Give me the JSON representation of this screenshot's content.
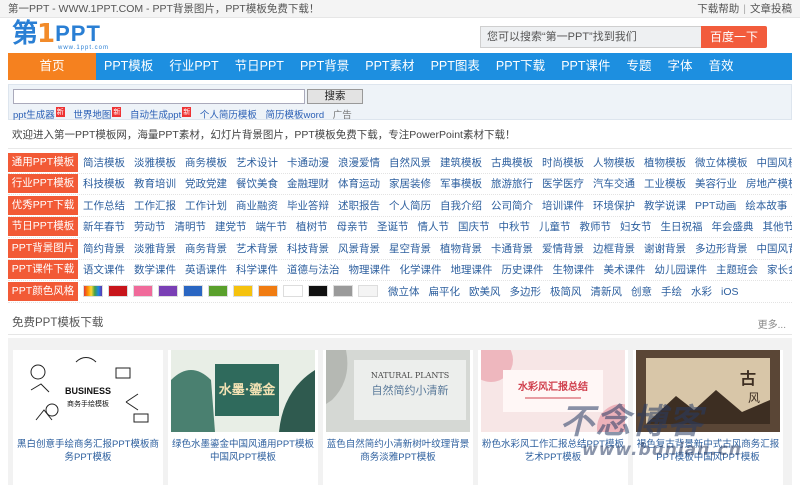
{
  "topbar": {
    "site_text": "第一PPT - WWW.1PPT.COM - PPT背景图片，PPT模板免费下载！",
    "links": [
      "下载帮助",
      "文章投稿"
    ]
  },
  "logo": {
    "part1": "第",
    "part2": "1",
    "part3": "PPT",
    "sub": "www.1ppt.com"
  },
  "search": {
    "placeholder": "您可以搜索“第一PPT”找到我们",
    "button": "百度一下"
  },
  "nav": {
    "home": "首页",
    "items": [
      "PPT模板",
      "行业PPT",
      "节日PPT",
      "PPT背景",
      "PPT素材",
      "PPT图表",
      "PPT下载",
      "PPT课件",
      "专题",
      "字体",
      "音效"
    ]
  },
  "subsearch": {
    "button": "搜索",
    "hot": [
      "ppt生成器",
      "世界地图",
      "自动生成ppt",
      "个人简历模板",
      "简历模板word",
      "广告"
    ],
    "new_badge": "新"
  },
  "welcome": "欢迎进入第一PPT模板网，海量PPT素材，幻灯片背景图片，PPT模板免费下载，专注PowerPoint素材下载！",
  "categories": [
    {
      "label": "通用PPT模板",
      "links": [
        "简洁模板",
        "淡雅模板",
        "商务模板",
        "艺术设计",
        "卡通动漫",
        "浪漫爱情",
        "自然风景",
        "建筑模板",
        "古典模板",
        "时尚模板",
        "人物模板",
        "植物模板",
        "微立体模板",
        "中国风模板"
      ]
    },
    {
      "label": "行业PPT模板",
      "links": [
        "科技模板",
        "教育培训",
        "党政党建",
        "餐饮美食",
        "金融理财",
        "体育运动",
        "家居装修",
        "军事模板",
        "旅游旅行",
        "医学医疗",
        "汽车交通",
        "工业模板",
        "美容行业",
        "房地产模板"
      ]
    },
    {
      "label": "优秀PPT下载",
      "links": [
        "工作总结",
        "工作汇报",
        "工作计划",
        "商业融资",
        "毕业答辩",
        "述职报告",
        "个人简历",
        "自我介绍",
        "公司简介",
        "培训课件",
        "环境保护",
        "教学说课",
        "PPT动画",
        "绘本故事"
      ]
    },
    {
      "label": "节日PPT模板",
      "links": [
        "新年春节",
        "劳动节",
        "清明节",
        "建党节",
        "端午节",
        "植树节",
        "母亲节",
        "圣诞节",
        "情人节",
        "国庆节",
        "中秋节",
        "儿童节",
        "教师节",
        "妇女节",
        "生日祝福",
        "年会盛典",
        "其他节日"
      ]
    },
    {
      "label": "PPT背景图片",
      "links": [
        "简约背景",
        "淡雅背景",
        "商务背景",
        "艺术背景",
        "科技背景",
        "风景背景",
        "星空背景",
        "植物背景",
        "卡通背景",
        "爱情背景",
        "边框背景",
        "谢谢背景",
        "多边形背景",
        "中国风背景"
      ]
    },
    {
      "label": "PPT课件下载",
      "links": [
        "语文课件",
        "数学课件",
        "英语课件",
        "科学课件",
        "道德与法治",
        "物理课件",
        "化学课件",
        "地理课件",
        "历史课件",
        "生物课件",
        "美术课件",
        "幼儿园课件",
        "主题班会",
        "家长会"
      ]
    },
    {
      "label": "PPT颜色风格",
      "links": [
        "微立体",
        "扁平化",
        "欧美风",
        "多边形",
        "极简风",
        "清新风",
        "创意",
        "手绘",
        "水彩",
        "iOS"
      ]
    }
  ],
  "color_swatches": [
    "rainbow",
    "#c8151b",
    "#f06a9a",
    "#7a3fb5",
    "#2a66c2",
    "#5aa02c",
    "#f5c20e",
    "#f07c12",
    "#ffffff",
    "#111111",
    "#9a9a9a",
    "#f4f4f4"
  ],
  "free_section": {
    "title": "免费PPT模板下载",
    "more": "更多..."
  },
  "thumbnails": [
    {
      "caption": "黑白创意手绘商务汇报PPT模板商务PPT模板",
      "img_text": [
        "BUSINESS",
        "商务手绘模板"
      ]
    },
    {
      "caption": "绿色水墨鎏金中国风通用PPT模板中国风PPT模板",
      "img_text": [
        "水墨·鎏金"
      ]
    },
    {
      "caption": "蓝色自然简约小清新树叶纹理背景商务淡雅PPT模板",
      "img_text": [
        "NATURAL PLANTS",
        "自然简约小清新"
      ]
    },
    {
      "caption": "粉色水彩风工作汇报总结PPT模板艺术PPT模板",
      "img_text": [
        "水彩风汇报总结"
      ]
    },
    {
      "caption": "褐色复古背景新中式古风商务汇报PPT模板中国风PPT模板",
      "img_text": [
        "古",
        "风"
      ]
    }
  ],
  "watermark": {
    "big": "不念博客",
    "url": "www.bunian.cn"
  }
}
